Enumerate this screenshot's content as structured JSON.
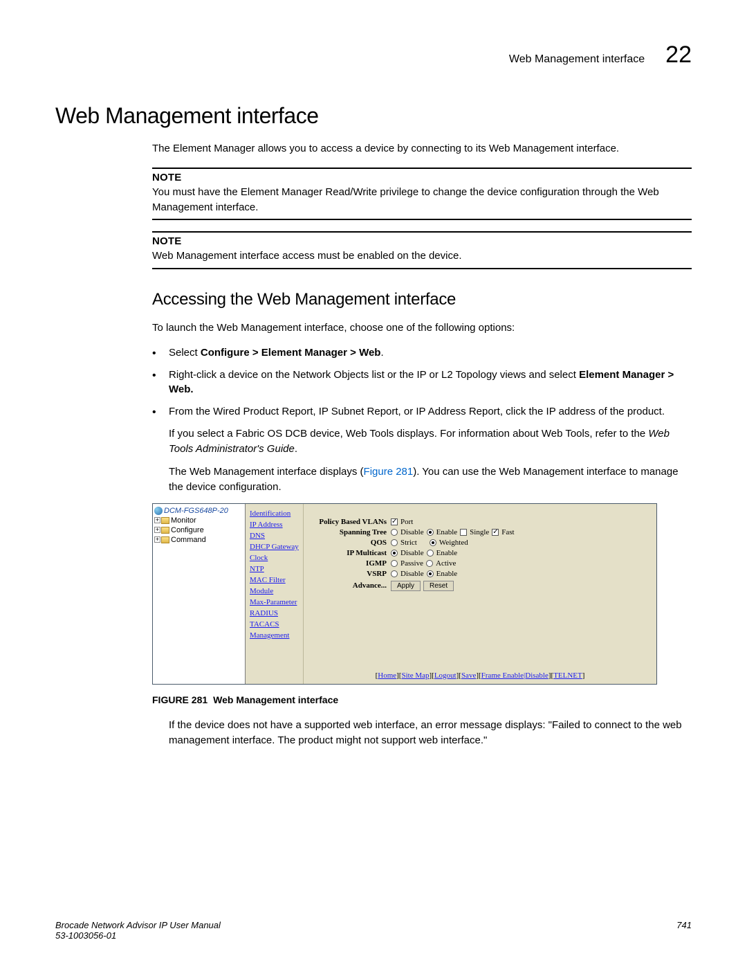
{
  "header": {
    "title": "Web Management interface",
    "chapter": "22"
  },
  "section": {
    "title": "Web Management interface",
    "intro": "The Element Manager allows you to access a device by connecting to its Web Management interface."
  },
  "notes": [
    {
      "label": "NOTE",
      "text": "You must have the Element Manager Read/Write privilege to change the device configuration through the Web Management interface."
    },
    {
      "label": "NOTE",
      "text": "Web Management interface access must be enabled on the device."
    }
  ],
  "subsection": {
    "title": "Accessing the Web Management interface",
    "lead": "To launch the Web Management interface, choose one of the following options:",
    "bullets": [
      {
        "pre": "Select ",
        "bold": "Configure > Element Manager > Web",
        "post": "."
      },
      {
        "pre": "Right-click a device on the Network Objects list or the IP or L2 Topology views and select ",
        "bold": "Element Manager > Web.",
        "post": ""
      },
      {
        "pre": "From the Wired Product Report, IP Subnet Report, or IP Address Report, click the IP address of the product.",
        "bold": "",
        "post": ""
      }
    ],
    "para_fabric_pre": "If you select a Fabric OS DCB device, Web Tools displays. For information about Web Tools, refer to the ",
    "para_fabric_italic": "Web Tools Administrator's Guide",
    "para_fabric_post": ".",
    "para_display_pre": "The Web Management interface displays (",
    "para_display_link": "Figure 281",
    "para_display_post": "). You can use the Web Management interface to manage the device configuration."
  },
  "screenshot": {
    "tree": {
      "root": "DCM-FGS648P-20",
      "items": [
        "Monitor",
        "Configure",
        "Command"
      ]
    },
    "menu": [
      "Identification",
      "IP Address",
      "DNS",
      "DHCP Gateway",
      "Clock",
      "NTP",
      "MAC Filter",
      "Module",
      "Max-Parameter",
      "RADIUS",
      "TACACS",
      "Management"
    ],
    "config": {
      "pbv_label": "Policy Based VLANs",
      "pbv_opt": "Port",
      "st_label": "Spanning Tree",
      "st_disable": "Disable",
      "st_enable": "Enable",
      "st_single": "Single",
      "st_fast": "Fast",
      "qos_label": "QOS",
      "qos_strict": "Strict",
      "qos_weighted": "Weighted",
      "ipm_label": "IP Multicast",
      "ipm_disable": "Disable",
      "ipm_enable": "Enable",
      "igmp_label": "IGMP",
      "igmp_passive": "Passive",
      "igmp_active": "Active",
      "vsrp_label": "VSRP",
      "vsrp_disable": "Disable",
      "vsrp_enable": "Enable",
      "advance_label": "Advance...",
      "apply_btn": "Apply",
      "reset_btn": "Reset"
    },
    "footer_links": [
      "Home",
      "Site Map",
      "Logout",
      "Save",
      "Frame Enable|Disable",
      "TELNET"
    ]
  },
  "figure": {
    "label": "FIGURE 281",
    "title": "Web Management interface"
  },
  "after_figure": "If the device does not have a supported web interface, an error message displays: \"Failed to connect to the web management interface. The product might not support web interface.\"",
  "footer": {
    "manual": "Brocade Network Advisor IP User Manual",
    "docid": "53-1003056-01",
    "page": "741"
  }
}
